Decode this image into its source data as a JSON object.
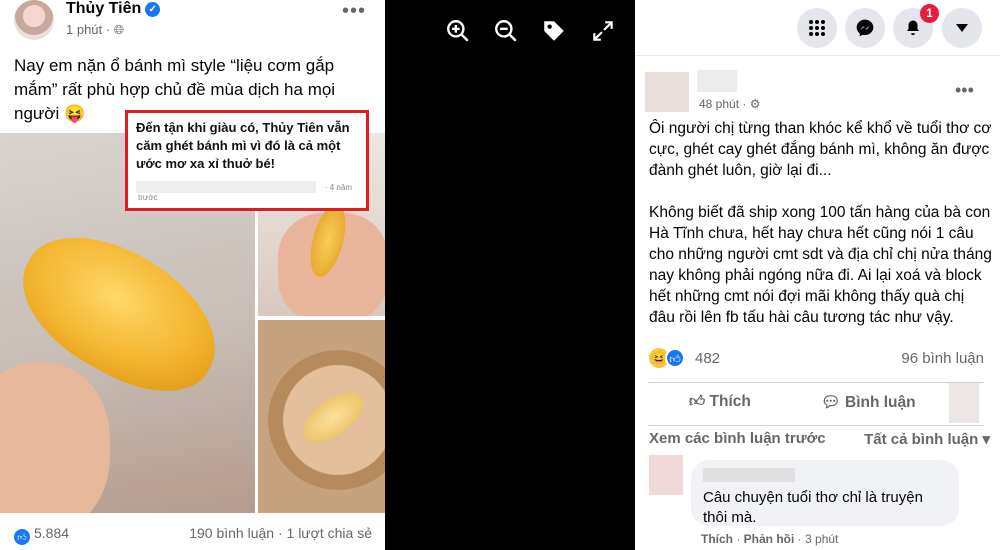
{
  "embedded_post": {
    "author": "Thủy Tiên",
    "time": "1 phút",
    "text": "Nay em nặn ổ bánh mì style “liệu cơm gắp mắm” rất phù hợp chủ đề mùa dịch ha mọi người 😝",
    "reaction_count": "5.884",
    "stats": "190 bình luận · 1 lượt chia sẻ"
  },
  "callout": {
    "title": "Đến tận khi giàu có, Thủy Tiên vẫn căm ghét bánh mì vì đó là cả một ước mơ xa xỉ thuở bé!",
    "age": "· 4 năm",
    "prev": "trước"
  },
  "viewer_tools": {
    "icons": [
      "zoom-in-icon",
      "zoom-out-icon",
      "tag-icon",
      "fullscreen-icon"
    ]
  },
  "topnav": {
    "notification_count": "1",
    "icons": [
      "grid-menu-icon",
      "messenger-icon",
      "bell-icon",
      "caret-down-icon"
    ]
  },
  "post": {
    "time": "48 phút ·",
    "paragraphs": [
      "Ôi người chị từng than khóc kể khổ về tuổi thơ cơ cực, ghét cay ghét đắng bánh mì, không ăn được đành ghét luôn, giờ lại đi...",
      "Không biết đã ship xong 100 tấn hàng của bà con Hà Tĩnh chưa, hết hay chưa hết cũng nói 1 câu cho những người cmt sdt và địa chỉ chị nửa tháng nay không phải ngóng nữa đi. Ai lại xoá và block hết những cmt nói đợi mãi không thấy quà chị đâu rồi lên fb tấu hài câu tương tác như vậy."
    ],
    "reaction_count": "482",
    "comment_count": "96 bình luận",
    "like_label": "Thích",
    "comment_label": "Bình luận"
  },
  "comments": {
    "view_previous": "Xem các bình luận trước",
    "filter": "Tất cả bình luận",
    "items": [
      {
        "text": "Câu chuyện tuổi thơ chỉ là truyện thôi mà.",
        "like": "Thích",
        "reply": "Phản hồi",
        "time": "3 phút"
      }
    ]
  },
  "colors": {
    "accent": "#1877f2",
    "badge": "#e41e3f",
    "callout_border": "#e01b22"
  }
}
